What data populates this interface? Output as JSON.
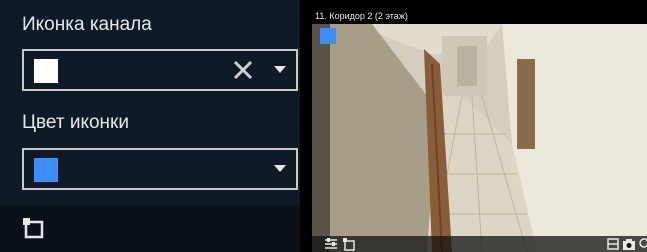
{
  "panel": {
    "icon_label": "Иконка канала",
    "icon_select": {
      "swatch_color": "#ffffff",
      "clear_icon": "close-icon",
      "caret_icon": "chevron-down-icon"
    },
    "color_label": "Цвет иконки",
    "color_select": {
      "swatch_color": "#3b8ff6",
      "caret_icon": "chevron-down-icon"
    },
    "bottom_icon": "channel-icon-toggle"
  },
  "camera": {
    "title": "11. Коридор 2 (2 этаж)",
    "channel_icon_color": "#3b8ff6",
    "toolbar_left": [
      "tuning-icon",
      "channel-icon"
    ],
    "toolbar_right": [
      "layout-icon",
      "camera-icon",
      "search-icon"
    ]
  }
}
